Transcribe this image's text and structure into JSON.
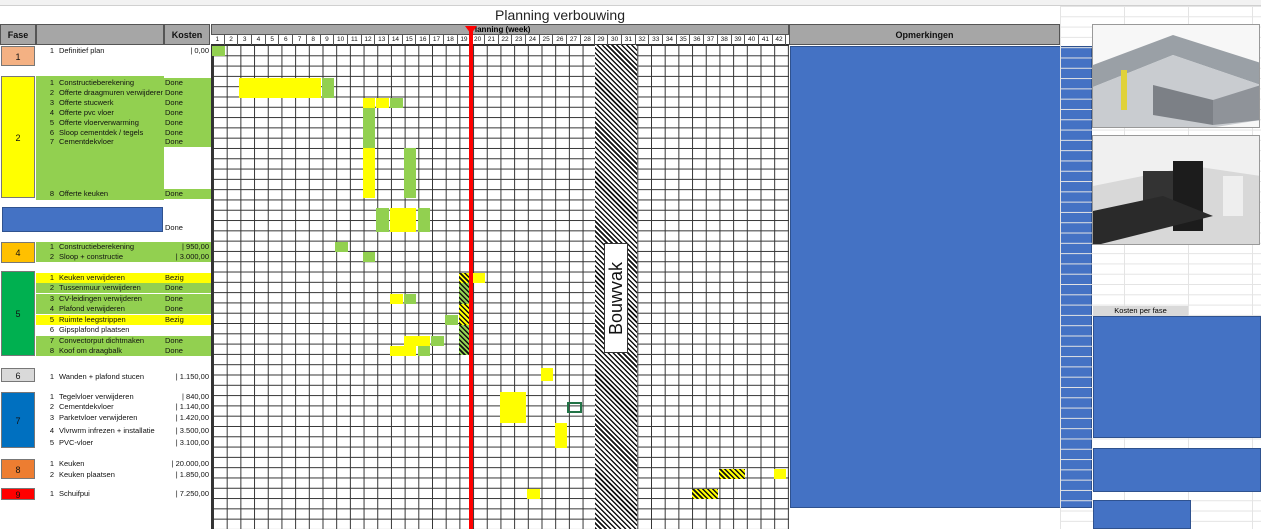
{
  "sheet_title": "Planning verbouwing",
  "headers": {
    "fase": "Fase",
    "kosten": "Kosten",
    "planning": "Planning (week)",
    "opmerkingen": "Opmerkingen"
  },
  "weeks": [
    "1",
    "2",
    "3",
    "4",
    "5",
    "6",
    "7",
    "8",
    "9",
    "10",
    "11",
    "12",
    "13",
    "14",
    "15",
    "16",
    "17",
    "18",
    "19",
    "20",
    "21",
    "22",
    "23",
    "24",
    "25",
    "26",
    "27",
    "28",
    "29",
    "30",
    "31",
    "32",
    "33",
    "34",
    "35",
    "36",
    "37",
    "38",
    "39",
    "40",
    "41",
    "42"
  ],
  "phases": [
    {
      "num": "1",
      "color": "#f4b183"
    },
    {
      "num": "2",
      "color": "#ffff00"
    },
    {
      "num": "4",
      "color": "#ffc000"
    },
    {
      "num": "5",
      "color": "#00b050"
    },
    {
      "num": "6",
      "color": "#d9d9d9"
    },
    {
      "num": "7",
      "color": "#0070c0"
    },
    {
      "num": "8",
      "color": "#ed7d31"
    },
    {
      "num": "9",
      "color": "#ff0000"
    }
  ],
  "tasks": [
    {
      "n": "1",
      "label": "Definitief plan",
      "status": "",
      "cost": "| 0,00"
    },
    {
      "n": "1",
      "label": "Constructieberekening",
      "status": "Done",
      "cost": ""
    },
    {
      "n": "2",
      "label": "Offerte draagmuren verwijderen",
      "status": "Done",
      "cost": ""
    },
    {
      "n": "3",
      "label": "Offerte stucwerk",
      "status": "Done",
      "cost": ""
    },
    {
      "n": "4",
      "label": "Offerte pvc vloer",
      "status": "Done",
      "cost": ""
    },
    {
      "n": "5",
      "label": "Offerte vloerverwarming",
      "status": "Done",
      "cost": ""
    },
    {
      "n": "6",
      "label": "Sloop cementdek / tegels",
      "status": "Done",
      "cost": ""
    },
    {
      "n": "7",
      "label": "Cementdekvloer",
      "status": "Done",
      "cost": ""
    },
    {
      "n": "8",
      "label": "Offerte keuken",
      "status": "Done",
      "cost": ""
    },
    {
      "n": "",
      "label": "",
      "status": "Done",
      "cost": ""
    },
    {
      "n": "1",
      "label": "Constructieberekening",
      "status": "",
      "cost": "| 950,00"
    },
    {
      "n": "2",
      "label": "Sloop + constructie",
      "status": "",
      "cost": "| 3.000,00"
    },
    {
      "n": "1",
      "label": "Keuken verwijderen",
      "status": "Bezig",
      "cost": ""
    },
    {
      "n": "2",
      "label": "Tussenmuur verwijderen",
      "status": "Done",
      "cost": ""
    },
    {
      "n": "3",
      "label": "CV-leidingen verwijderen",
      "status": "Done",
      "cost": ""
    },
    {
      "n": "4",
      "label": "Plafond verwijderen",
      "status": "Done",
      "cost": ""
    },
    {
      "n": "5",
      "label": "Ruimte leegstrippen",
      "status": "Bezig",
      "cost": ""
    },
    {
      "n": "6",
      "label": "Gipsplafond plaatsen",
      "status": "",
      "cost": ""
    },
    {
      "n": "7",
      "label": "Convectorput dichtmaken",
      "status": "Done",
      "cost": ""
    },
    {
      "n": "8",
      "label": "Koof om draagbalk",
      "status": "Done",
      "cost": ""
    },
    {
      "n": "1",
      "label": "Wanden + plafond stucen",
      "status": "",
      "cost": "| 1.150,00"
    },
    {
      "n": "1",
      "label": "Tegelvloer verwijderen",
      "status": "",
      "cost": "| 840,00"
    },
    {
      "n": "2",
      "label": "Cementdekvloer",
      "status": "",
      "cost": "| 1.140,00"
    },
    {
      "n": "3",
      "label": "Parketvloer verwijderen",
      "status": "",
      "cost": "| 1.420,00"
    },
    {
      "n": "4",
      "label": "Vlvrwrm infrezen + installatie",
      "status": "",
      "cost": "| 3.500,00"
    },
    {
      "n": "5",
      "label": "PVC-vloer",
      "status": "",
      "cost": "| 3.100,00"
    },
    {
      "n": "1",
      "label": "Keuken",
      "status": "",
      "cost": "| 20.000,00"
    },
    {
      "n": "2",
      "label": "Keuken plaatsen",
      "status": "",
      "cost": "| 1.850,00"
    },
    {
      "n": "1",
      "label": "Schuifpui",
      "status": "",
      "cost": "| 7.250,00"
    }
  ],
  "bouwvak_label": "Bouwvak",
  "kosten_per_fase": "Kosten per fase",
  "colors": {
    "done_green": "#92d050",
    "bezig_yellow": "#ffff00",
    "header_grey": "#a6a6a6",
    "today_line": "#ff0000",
    "chart_blue": "#4472c4"
  },
  "images": [
    "kitchen-render-3d-icon",
    "kitchen-render-photo-icon"
  ]
}
